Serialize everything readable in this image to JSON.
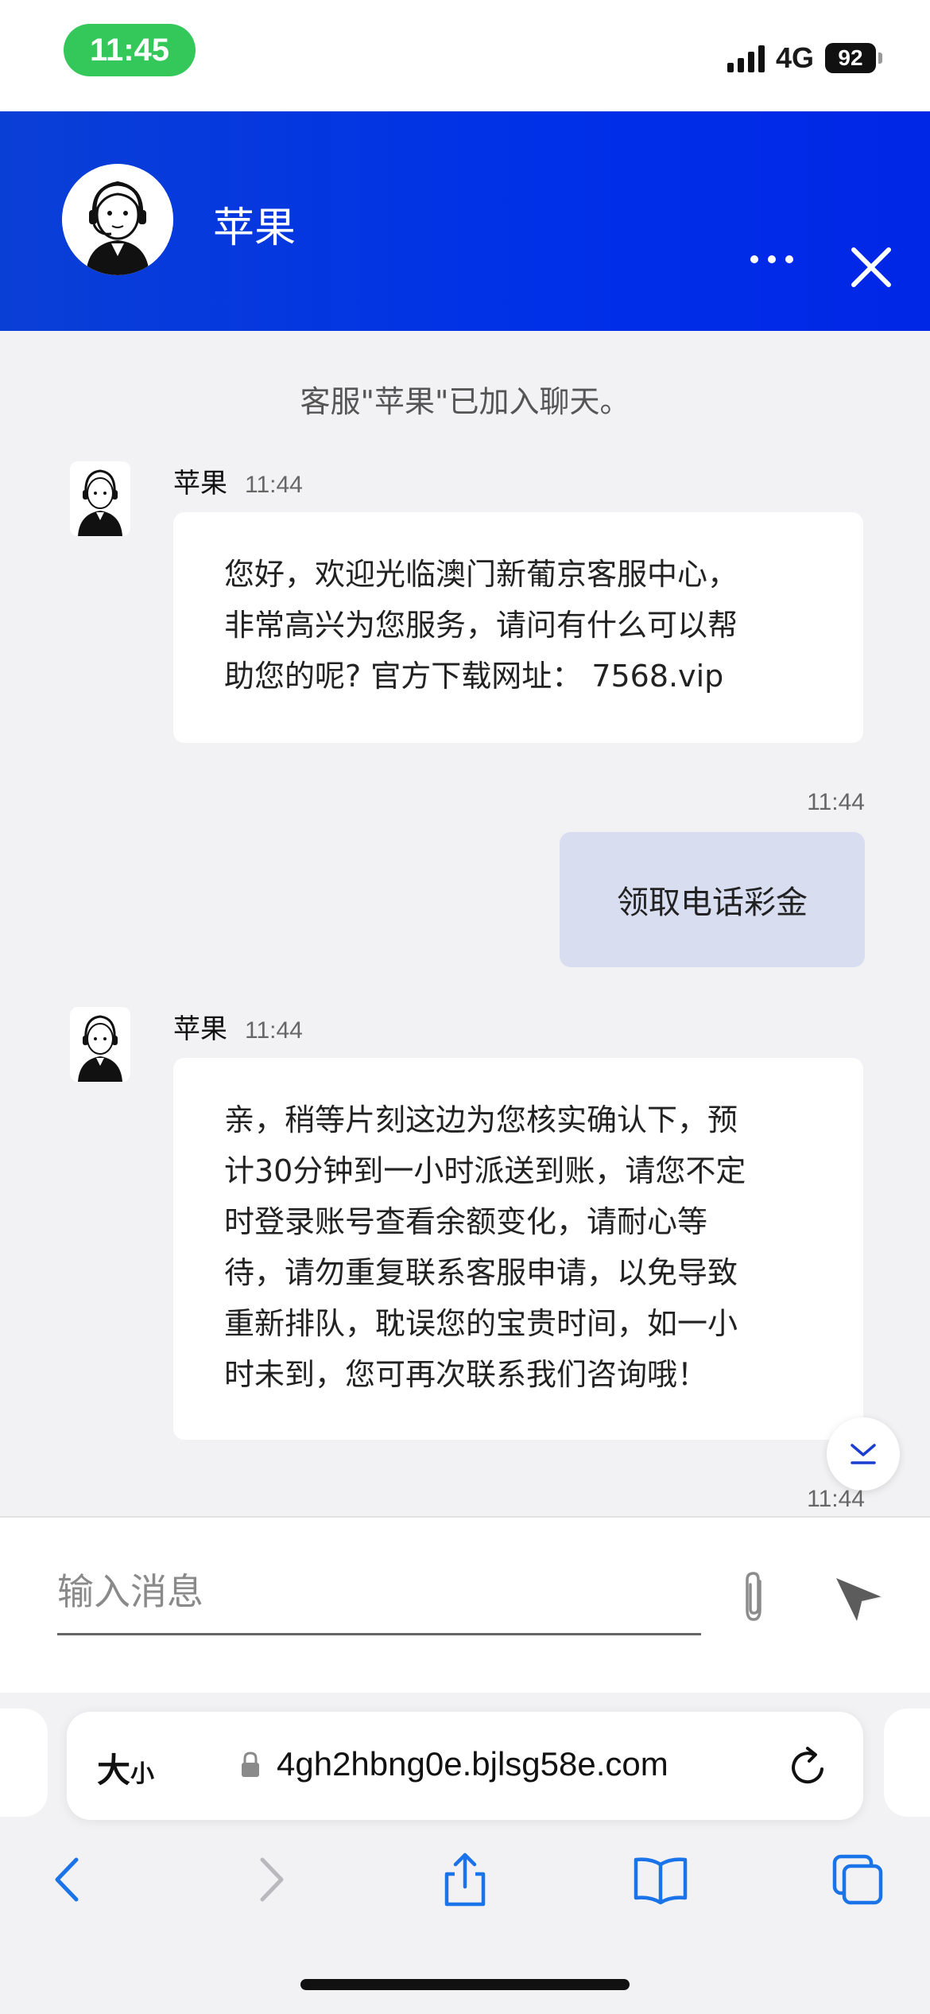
{
  "status_bar": {
    "time": "11:45",
    "network": "4G",
    "battery": "92"
  },
  "header": {
    "agent_name": "苹果",
    "menu_icon": "more-horizontal-icon",
    "close_icon": "close-icon",
    "brand_color": "#0030e8"
  },
  "chat": {
    "system_notice": "客服\"苹果\"已加入聊天。",
    "messages": [
      {
        "sender": "苹果",
        "time": "11:44",
        "lines": [
          "您好，欢迎光临澳门新葡京客服中心，",
          "非常高兴为您服务，请问有什么可以帮",
          "助您的呢? 官方下载网址： 7568.vip"
        ]
      },
      {
        "time": "11:44",
        "text": "领取电话彩金"
      },
      {
        "sender": "苹果",
        "time": "11:44",
        "lines": [
          "亲，稍等片刻这边为您核实确认下，预",
          "计30分钟到一小时派送到账，请您不定",
          "时登录账号查看余额变化，请耐心等",
          "待，请勿重复联系客服申请，以免导致",
          "重新排队，耽误您的宝贵时间，如一小",
          "时未到，您可再次联系我们咨询哦！"
        ]
      }
    ],
    "trailing_time": "11:44"
  },
  "input": {
    "placeholder": "输入消息",
    "value": ""
  },
  "browser": {
    "text_size_label_big": "大",
    "text_size_label_small": "小",
    "url": "4gh2hbng0e.bjlsg58e.com",
    "accent_color": "#1a73e8"
  }
}
